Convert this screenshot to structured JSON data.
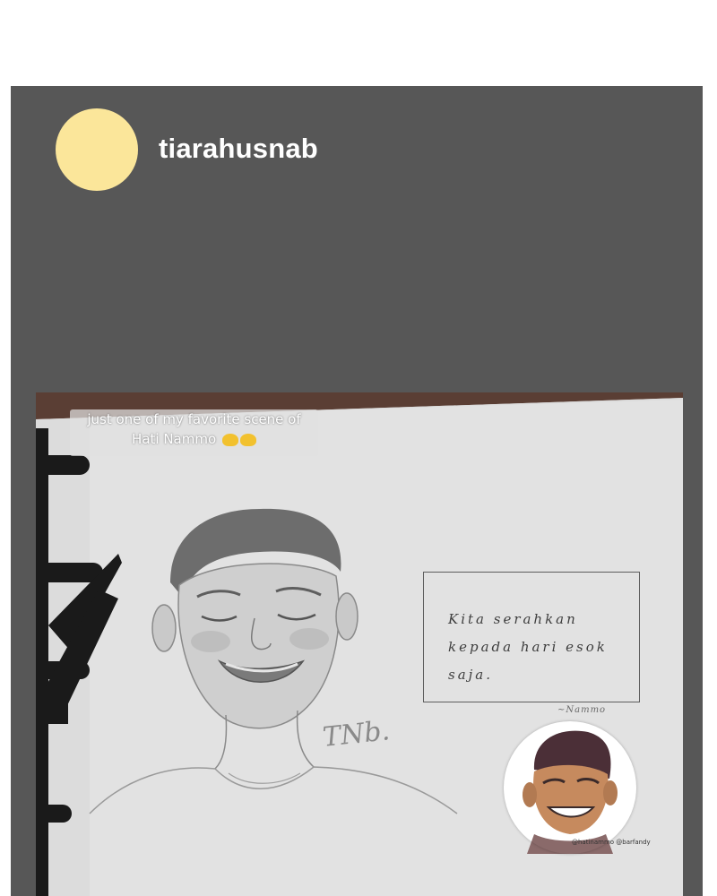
{
  "profile": {
    "username": "tiarahusnab",
    "avatar_color": "#fbe69a"
  },
  "post": {
    "background_color": "#575757",
    "caption_lines": [
      "just one of my favorite scene of",
      "Hati Nammo"
    ],
    "caption_emoji": "face-emoji",
    "quote_lines": [
      "Kita serahkan",
      "kepada hari esok",
      "saja."
    ],
    "quote_attribution": "~Nammo",
    "signature": "TNb.",
    "sticker_credit": "@hatinammo @barfandy"
  }
}
